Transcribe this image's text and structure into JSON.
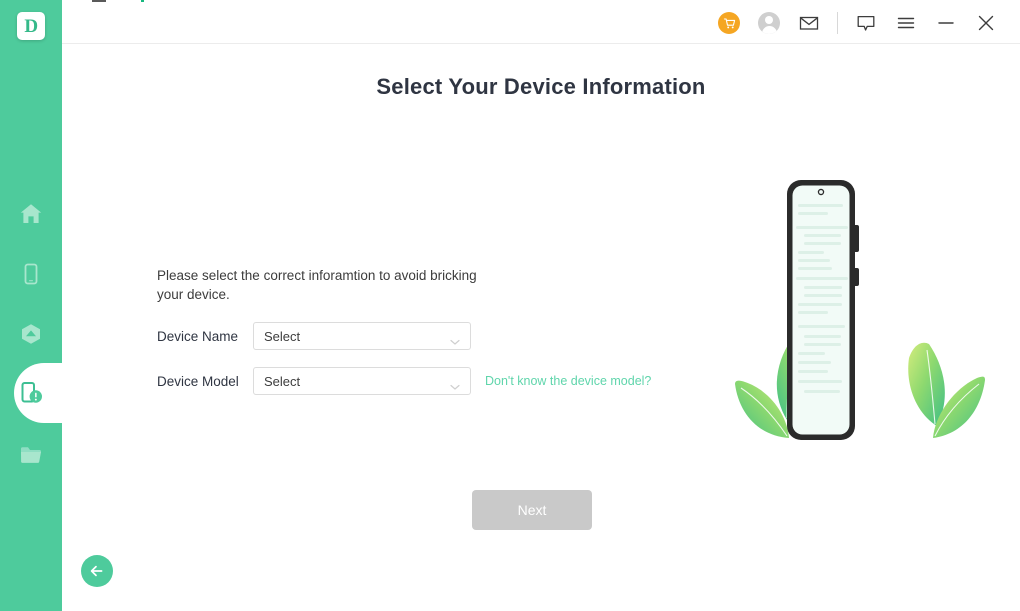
{
  "app": {
    "logo_letter": "D",
    "accent_color": "#4ecb9c",
    "title_color": "#2f3542",
    "link_color": "#5fd5ab",
    "cart_color": "#f5a623",
    "disabled_button_color": "#c9c9c9"
  },
  "titlebar": {
    "icons": [
      {
        "name": "cart-icon",
        "label": "Shopping Cart"
      },
      {
        "name": "account-icon",
        "label": "Account"
      },
      {
        "name": "mail-icon",
        "label": "Mail"
      },
      {
        "name": "feedback-icon",
        "label": "Feedback"
      },
      {
        "name": "menu-icon",
        "label": "Menu"
      },
      {
        "name": "minimize-icon",
        "label": "Minimize"
      },
      {
        "name": "close-icon",
        "label": "Close"
      }
    ]
  },
  "sidebar": {
    "items": [
      {
        "name": "sidebar-item-home",
        "icon": "home-icon",
        "label": "Home",
        "active": false
      },
      {
        "name": "sidebar-item-phone",
        "icon": "phone-icon",
        "label": "Phone",
        "active": false
      },
      {
        "name": "sidebar-item-backup",
        "icon": "cloud-backup-icon",
        "label": "Backup",
        "active": false
      },
      {
        "name": "sidebar-item-system-repair",
        "icon": "phone-alert-icon",
        "label": "System Repair",
        "active": true
      },
      {
        "name": "sidebar-item-files",
        "icon": "folder-icon",
        "label": "Files",
        "active": false
      }
    ],
    "back_button": {
      "name": "back-button",
      "icon": "arrow-left-icon",
      "label": "Back"
    }
  },
  "main": {
    "title": "Select Your Device Information",
    "instruction": "Please select the correct inforamtion to avoid bricking your device.",
    "fields": [
      {
        "label": "Device Name",
        "value": "Select",
        "placeholder": "Select"
      },
      {
        "label": "Device Model",
        "value": "Select",
        "placeholder": "Select"
      }
    ],
    "hint_link": "Don't know the device model?",
    "next_button": "Next"
  }
}
